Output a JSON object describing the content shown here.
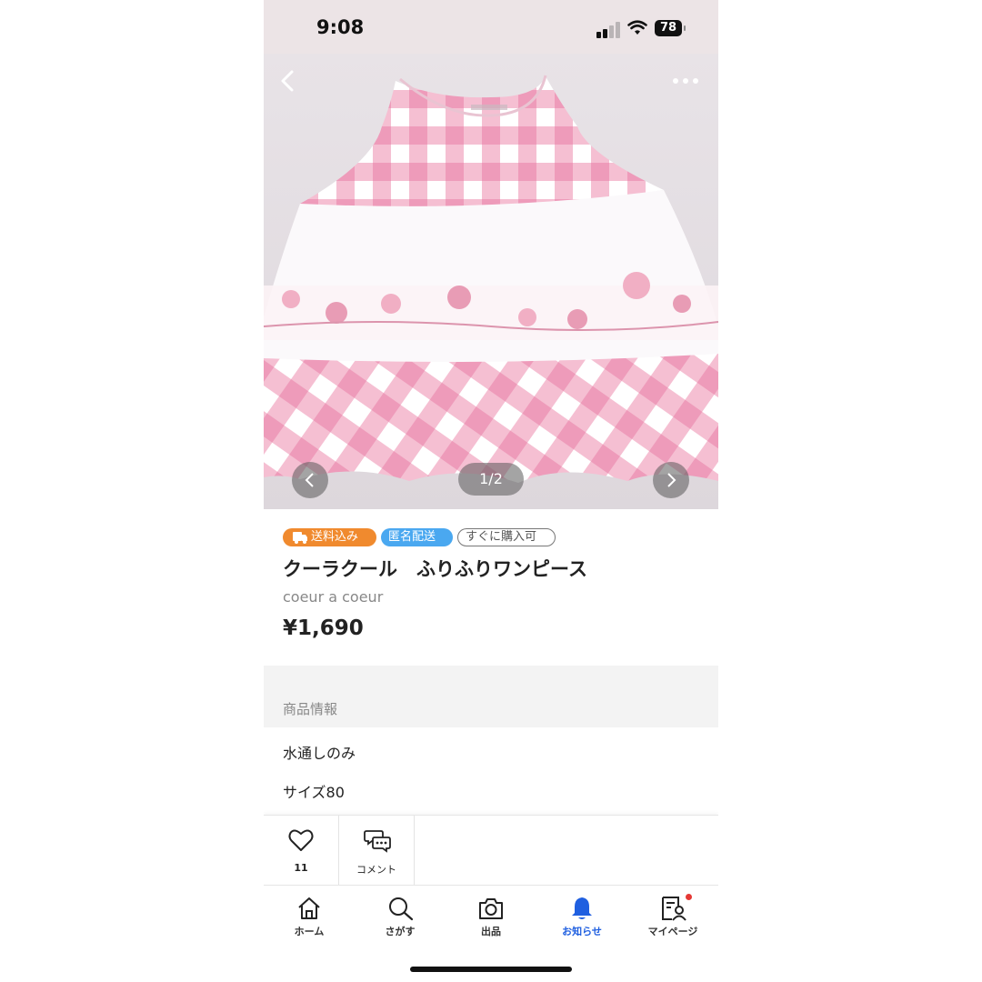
{
  "status_bar": {
    "time": "9:08",
    "battery": "78"
  },
  "photo": {
    "counter": "1/2"
  },
  "tags": {
    "shipping_included": "送料込み",
    "anonymous": "匿名配送",
    "instant_buy": "すぐに購入可"
  },
  "product": {
    "title": "クーラクール　ふりふりワンピース",
    "brand": "coeur a coeur",
    "price": "¥1,690"
  },
  "section": {
    "heading": "商品情報"
  },
  "description": {
    "line1": "水通しのみ",
    "line2": "サイズ80"
  },
  "actions": {
    "likes_count": "11",
    "comment_label": "コメント"
  },
  "tab_bar": {
    "home": "ホーム",
    "search": "さがす",
    "sell": "出品",
    "notifications": "お知らせ",
    "mypage": "マイページ",
    "active_tab": "notifications"
  },
  "colors": {
    "accent_blue": "#1f5fe0",
    "tag_orange": "#f08a2e",
    "tag_blue": "#4aa8f0",
    "gingham_pink": "#f2a9c3"
  }
}
